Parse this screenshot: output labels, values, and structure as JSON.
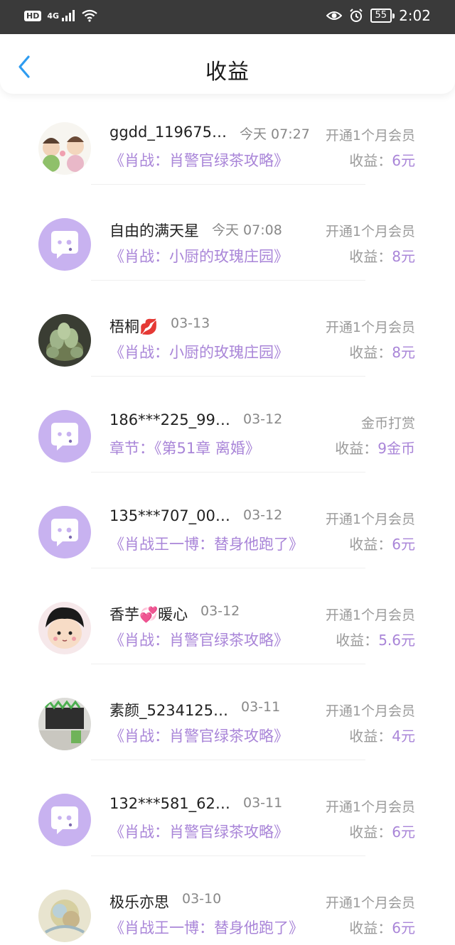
{
  "status_bar": {
    "hd": "HD",
    "network": "4G",
    "battery": "55",
    "time": "2:02"
  },
  "header": {
    "title": "收益"
  },
  "colors": {
    "accent": "#a985d8",
    "avatar_default": "#c8b2f0",
    "back": "#2e9cf0"
  },
  "items": [
    {
      "name": "ggdd_119675…",
      "time": "今天 07:27",
      "type": "开通1个月会员",
      "work": "《肖战：肖警官绿茶攻略》",
      "earn_label": "收益：",
      "amount": "6元",
      "avatar": "cartoon-pair-avatar"
    },
    {
      "name": "自由的满天星",
      "time": "今天 07:08",
      "type": "开通1个月会员",
      "work": "《肖战：小厨的玫瑰庄园》",
      "earn_label": "收益：",
      "amount": "8元",
      "avatar": "default-chat-avatar"
    },
    {
      "name": "梧桐💋",
      "time": "03-13",
      "type": "开通1个月会员",
      "work": "《肖战：小厨的玫瑰庄园》",
      "earn_label": "收益：",
      "amount": "8元",
      "avatar": "succulent-avatar"
    },
    {
      "name": "186***225_99…",
      "time": "03-12",
      "type": "金币打赏",
      "work": "章节：《第51章 离婚》",
      "earn_label": "收益：",
      "amount": "9金币",
      "avatar": "default-chat-avatar"
    },
    {
      "name": "135***707_00…",
      "time": "03-12",
      "type": "开通1个月会员",
      "work": "《肖战王一博：替身他跑了》",
      "earn_label": "收益：",
      "amount": "6元",
      "avatar": "default-chat-avatar"
    },
    {
      "name": "香芋💞暖心",
      "time": "03-12",
      "type": "开通1个月会员",
      "work": "《肖战：肖警官绿茶攻略》",
      "earn_label": "收益：",
      "amount": "5.6元",
      "avatar": "cartoon-kid-avatar"
    },
    {
      "name": "素颜_5234125…",
      "time": "03-11",
      "type": "开通1个月会员",
      "work": "《肖战：肖警官绿茶攻略》",
      "earn_label": "收益：",
      "amount": "4元",
      "avatar": "room-photo-avatar"
    },
    {
      "name": "132***581_62…",
      "time": "03-11",
      "type": "开通1个月会员",
      "work": "《肖战：肖警官绿茶攻略》",
      "earn_label": "收益：",
      "amount": "6元",
      "avatar": "default-chat-avatar"
    },
    {
      "name": "极乐亦思",
      "time": "03-10",
      "type": "开通1个月会员",
      "work": "《肖战王一博：替身他跑了》",
      "earn_label": "收益：",
      "amount": "6元",
      "avatar": "painting-avatar"
    }
  ]
}
